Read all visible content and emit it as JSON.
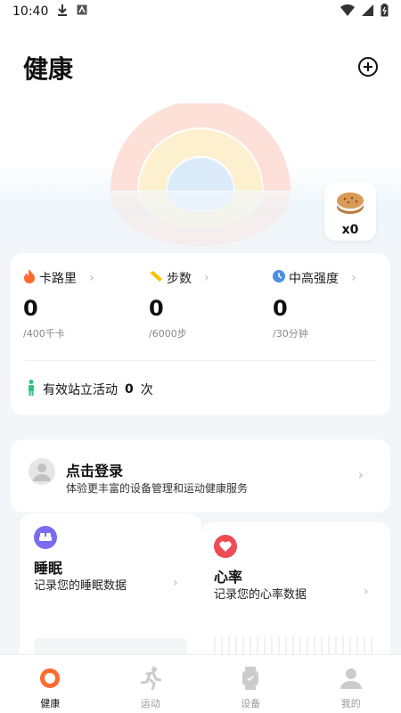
{
  "status": {
    "time": "10:40"
  },
  "header": {
    "title": "健康"
  },
  "badge": {
    "count": "x0"
  },
  "metrics": [
    {
      "label": "卡路里",
      "value": "0",
      "goal": "/400千卡",
      "icon": "flame-icon",
      "color": "#ff6a2f"
    },
    {
      "label": "步数",
      "value": "0",
      "goal": "/6000步",
      "icon": "shoe-icon",
      "color": "#f7c40a"
    },
    {
      "label": "中高强度",
      "value": "0",
      "goal": "/30分钟",
      "icon": "clock-icon",
      "color": "#4a90e2"
    }
  ],
  "stand": {
    "prefix": "有效站立活动",
    "count": "0",
    "unit": "次"
  },
  "login": {
    "title": "点击登录",
    "subtitle": "体验更丰富的设备管理和运动健康服务"
  },
  "sleep": {
    "title": "睡眠",
    "subtitle": "记录您的睡眠数据",
    "color": "#7a6cf0"
  },
  "heart": {
    "title": "心率",
    "subtitle": "记录您的心率数据",
    "color": "#ee4b55"
  },
  "tabs": [
    {
      "label": "健康",
      "active": true
    },
    {
      "label": "运动",
      "active": false
    },
    {
      "label": "设备",
      "active": false
    },
    {
      "label": "我的",
      "active": false
    }
  ],
  "colors": {
    "accent": "#ff6a2f"
  }
}
